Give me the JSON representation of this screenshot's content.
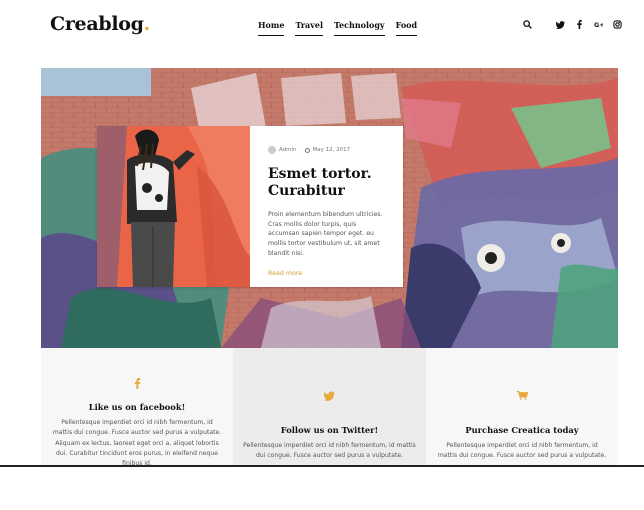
{
  "logo": {
    "text": "Creablog",
    "dot": "."
  },
  "nav": [
    {
      "label": "Home"
    },
    {
      "label": "Travel"
    },
    {
      "label": "Technology"
    },
    {
      "label": "Food"
    }
  ],
  "header_icons": [
    "search-icon",
    "twitter-icon",
    "facebook-icon",
    "google-plus-icon",
    "instagram-icon"
  ],
  "featured": {
    "author": "Admin",
    "date": "May 12, 2017",
    "title": "Esmet tortor. Curabitur",
    "excerpt": "Proin elementum bibendum ultricies. Cras mollis dolor turpis, quis accumsan sapien tempor eget. eu mollis tortor vestibulum ut, sit amet blandit nisi.",
    "read_more": "Read more"
  },
  "boxes": [
    {
      "icon": "facebook-icon",
      "title": "Like us on facebook!",
      "text": "Pellentesque imperdiet orci id nibh fermentum, id mattis dui congue. Fusce auctor sed purus a vulputate. Aliquam ex lectus, laoreet eget orci a, aliquet lobortis dui. Curabitur tincidunt eros purus, in eleifend neque finibus id."
    },
    {
      "icon": "twitter-icon",
      "title": "Follow us on Twitter!",
      "text": "Pellentesque imperdiet orci id nibh fermentum, id mattis dui congue. Fusce auctor sed purus a vulputate."
    },
    {
      "icon": "cart-icon",
      "title": "Purchase Creatica today",
      "text": "Pellentesque imperdiet orci id nibh fermentum, id mattis dui congue. Fusce auctor sed purus a vulputate."
    }
  ],
  "colors": {
    "accent": "#e8a93a",
    "text": "#111111"
  }
}
